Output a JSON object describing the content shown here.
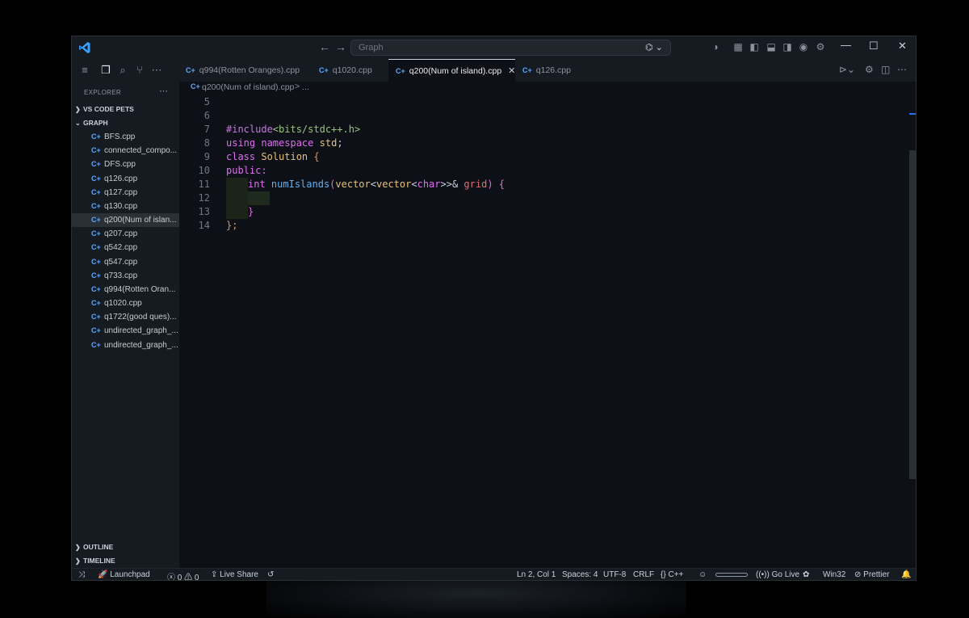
{
  "titlebar": {
    "command_center_text": "Graph",
    "copilot_icon": "copilot-icon",
    "back_icon": "arrow-left-icon",
    "forward_icon": "arrow-right-icon"
  },
  "activity": {
    "menu_icon": "hamburger-menu-icon",
    "explorer_icon": "files-icon",
    "search_icon": "search-icon",
    "scm_icon": "source-control-icon",
    "more_icon": "ellipsis-icon"
  },
  "sidebar": {
    "title": "EXPLORER",
    "sections": [
      {
        "label": "VS CODE PETS",
        "expanded": false
      },
      {
        "label": "GRAPH",
        "expanded": true
      }
    ],
    "files": [
      "BFS.cpp",
      "connected_compo...",
      "DFS.cpp",
      "q126.cpp",
      "q127.cpp",
      "q130.cpp",
      "q200(Num of islan...",
      "q207.cpp",
      "q542.cpp",
      "q547.cpp",
      "q733.cpp",
      "q994(Rotten Oran...",
      "q1020.cpp",
      "q1722(good ques)...",
      "undirected_graph_...",
      "undirected_graph_..."
    ],
    "active_index": 6,
    "outline_label": "OUTLINE",
    "timeline_label": "TIMELINE"
  },
  "tabs": [
    {
      "label": "q994(Rotten Oranges).cpp",
      "active": false
    },
    {
      "label": "q1020.cpp",
      "active": false
    },
    {
      "label": "q200(Num of island).cpp",
      "active": true
    },
    {
      "label": "q126.cpp",
      "active": false
    }
  ],
  "breadcrumb": {
    "file": "q200(Num of island).cpp",
    "separator": ">",
    "more": "..."
  },
  "editor": {
    "line_numbers": [
      "5",
      "6",
      "7",
      "8",
      "9",
      "10",
      "11",
      "12",
      "13",
      "14"
    ],
    "tokens": {
      "l7_pp": "#include",
      "l7_hdr": "<bits/stdc++.h>",
      "l8_using": "using",
      "l8_ns": "namespace",
      "l8_std": "std",
      "l8_semi": ";",
      "l9_class": "class",
      "l9_name": "Solution",
      "l9_brace": "{",
      "l10_public": "public:",
      "l11_int": "int",
      "l11_fn": "numIslands",
      "l11_open": "(",
      "l11_t1": "vector",
      "l11_lt1": "<",
      "l11_t2": "vector",
      "l11_lt2": "<",
      "l11_char": "char",
      "l11_gt": ">>&",
      "l11_param": "grid",
      "l11_close": ")",
      "l11_brace": "{",
      "l13_brace": "}",
      "l14_end": "};"
    }
  },
  "statusbar": {
    "remote_icon": "remote-icon",
    "launchpad": "Launchpad",
    "errors": "0",
    "warnings": "0",
    "live_share": "Live Share",
    "position": "Ln 2, Col 1",
    "spaces": "Spaces: 4",
    "encoding": "UTF-8",
    "eol": "CRLF",
    "language": "C++",
    "go_live": "Go Live",
    "platform": "Win32",
    "prettier": "Prettier"
  }
}
